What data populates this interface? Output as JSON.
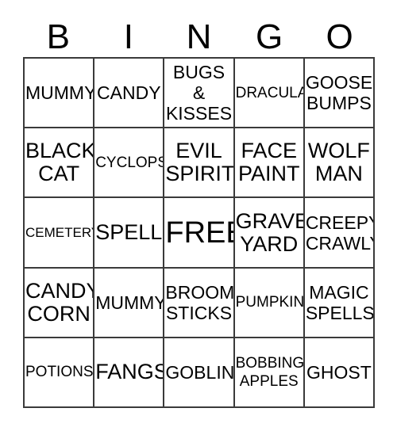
{
  "card": {
    "title": "BINGO",
    "header_letters": [
      "B",
      "I",
      "N",
      "G",
      "O"
    ],
    "columns": 5,
    "rows": 5,
    "border_color": "#3a3a3a",
    "background_color": "#ffffff",
    "text_color": "#000000",
    "free_space": "FREE",
    "free_space_position": "row 3, column N",
    "cells": [
      [
        {
          "label": "MUMMY",
          "size": "m"
        },
        {
          "label": "CANDY",
          "size": "m"
        },
        {
          "label": "BUGS\n&\nKISSES",
          "size": "m"
        },
        {
          "label": "DRACULA",
          "size": "s"
        },
        {
          "label": "GOOSE\nBUMPS",
          "size": "m"
        }
      ],
      [
        {
          "label": "BLACK\nCAT",
          "size": "l"
        },
        {
          "label": "CYCLOPS",
          "size": "s"
        },
        {
          "label": "EVIL\nSPIRIT",
          "size": "l"
        },
        {
          "label": "FACE\nPAINT",
          "size": "l"
        },
        {
          "label": "WOLF\nMAN",
          "size": "l"
        }
      ],
      [
        {
          "label": "CEMETERY",
          "size": "xs"
        },
        {
          "label": "SPELLS",
          "size": "l"
        },
        {
          "label": "FREE",
          "size": "xl"
        },
        {
          "label": "GRAVE\nYARD",
          "size": "l"
        },
        {
          "label": "CREEPY\nCRAWLY",
          "size": "m"
        }
      ],
      [
        {
          "label": "CANDY\nCORN",
          "size": "l"
        },
        {
          "label": "MUMMY",
          "size": "m"
        },
        {
          "label": "BROOM\nSTICKS",
          "size": "m"
        },
        {
          "label": "PUMPKIN",
          "size": "s"
        },
        {
          "label": "MAGIC\nSPELLS",
          "size": "m"
        }
      ],
      [
        {
          "label": "POTIONS",
          "size": "s"
        },
        {
          "label": "FANGS",
          "size": "l"
        },
        {
          "label": "GOBLIN",
          "size": "m"
        },
        {
          "label": "BOBBING\nAPPLES",
          "size": "s"
        },
        {
          "label": "GHOST",
          "size": "m"
        }
      ]
    ]
  }
}
